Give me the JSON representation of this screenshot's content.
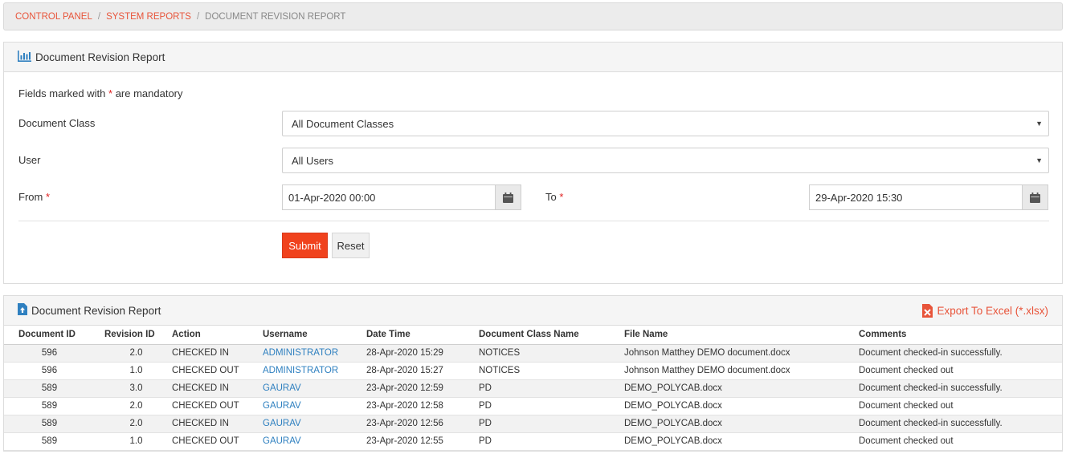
{
  "breadcrumb": {
    "items": [
      "CONTROL PANEL",
      "SYSTEM REPORTS"
    ],
    "current": "DOCUMENT REVISION REPORT",
    "separator": "/"
  },
  "filter_panel": {
    "title": "Document Revision Report",
    "mandatory_prefix": "Fields marked with",
    "mandatory_star": "*",
    "mandatory_suffix": "are mandatory",
    "document_class_label": "Document Class",
    "document_class_value": "All Document Classes",
    "user_label": "User",
    "user_value": "All Users",
    "from_label": "From",
    "from_value": "01-Apr-2020 00:00",
    "to_label": "To",
    "to_value": "29-Apr-2020 15:30",
    "required_star": "*",
    "submit_label": "Submit",
    "reset_label": "Reset"
  },
  "results_panel": {
    "title": "Document Revision Report",
    "export_label": "Export To Excel (*.xlsx)",
    "columns": [
      "Document ID",
      "Revision ID",
      "Action",
      "Username",
      "Date Time",
      "Document Class Name",
      "File Name",
      "Comments"
    ],
    "rows": [
      [
        "596",
        "2.0",
        "CHECKED IN",
        "ADMINISTRATOR",
        "28-Apr-2020 15:29",
        "NOTICES",
        "Johnson Matthey DEMO document.docx",
        "Document checked-in successfully."
      ],
      [
        "596",
        "1.0",
        "CHECKED OUT",
        "ADMINISTRATOR",
        "28-Apr-2020 15:27",
        "NOTICES",
        "Johnson Matthey DEMO document.docx",
        "Document checked out"
      ],
      [
        "589",
        "3.0",
        "CHECKED IN",
        "GAURAV",
        "23-Apr-2020 12:59",
        "PD",
        "DEMO_POLYCAB.docx",
        "Document checked-in successfully."
      ],
      [
        "589",
        "2.0",
        "CHECKED OUT",
        "GAURAV",
        "23-Apr-2020 12:58",
        "PD",
        "DEMO_POLYCAB.docx",
        "Document checked out"
      ],
      [
        "589",
        "2.0",
        "CHECKED IN",
        "GAURAV",
        "23-Apr-2020 12:56",
        "PD",
        "DEMO_POLYCAB.docx",
        "Document checked-in successfully."
      ],
      [
        "589",
        "1.0",
        "CHECKED OUT",
        "GAURAV",
        "23-Apr-2020 12:55",
        "PD",
        "DEMO_POLYCAB.docx",
        "Document checked out"
      ]
    ]
  },
  "colors": {
    "accent": "#f0421d",
    "link": "#2f80c0",
    "breadcrumb_link": "#e8543a",
    "required": "#e02020"
  },
  "icons": {
    "report_header": "bar-chart-icon",
    "results_header": "file-upload-icon",
    "calendar": "calendar-icon",
    "excel": "excel-file-icon",
    "dropdown": "caret-down-icon"
  }
}
